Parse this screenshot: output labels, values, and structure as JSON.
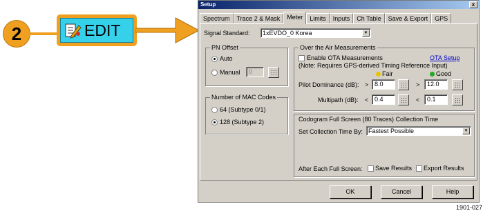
{
  "callout": {
    "step_number": "2",
    "edit_label": "EDIT"
  },
  "dialog": {
    "title": "Setup",
    "close_label": "x",
    "tabs": [
      "Spectrum",
      "Trace 2 & Mask",
      "Meter",
      "Limits",
      "Inputs",
      "Ch Table",
      "Save & Export",
      "GPS"
    ],
    "active_tab": "Meter",
    "signal_standard": {
      "label": "Signal Standard:",
      "value": "1xEVDO_0 Korea"
    },
    "pn_offset": {
      "title": "PN Offset",
      "auto_label": "Auto",
      "manual_label": "Manual",
      "manual_value": "0",
      "selected": "Auto"
    },
    "mac_codes": {
      "title": "Number of MAC Codes",
      "option1": "64 (Subtype 0/1)",
      "option2": "128 (Subtype 2)",
      "selected": "128 (Subtype 2)"
    },
    "ota": {
      "title": "Over the Air Measurements",
      "enable_label": "Enable OTA Measurements",
      "enable_checked": false,
      "setup_link": "OTA Setup",
      "note": "(Note: Requires GPS-derived Timing Reference Input)",
      "fair_label": "Fair",
      "good_label": "Good",
      "fair_color": "#e8c400",
      "good_color": "#22aa22",
      "pilot_label": "Pilot Dominance (dB):",
      "pilot_fair_op": ">",
      "pilot_fair_value": "8.0",
      "pilot_good_op": ">",
      "pilot_good_value": "12.0",
      "multipath_label": "Multipath (dB):",
      "multi_fair_op": "<",
      "multi_fair_value": "0.4",
      "multi_good_op": "<",
      "multi_good_value": "0.1"
    },
    "codogram": {
      "title": "Codogram Full Screen (80 Traces) Collection Time",
      "set_label": "Set Collection Time By:",
      "set_value": "Fastest Possible",
      "after_label": "After Each Full Screen:",
      "save_label": "Save Results",
      "export_label": "Export Results"
    },
    "buttons": {
      "ok": "OK",
      "cancel": "Cancel",
      "help": "Help"
    }
  },
  "figure_number": "1901-027"
}
